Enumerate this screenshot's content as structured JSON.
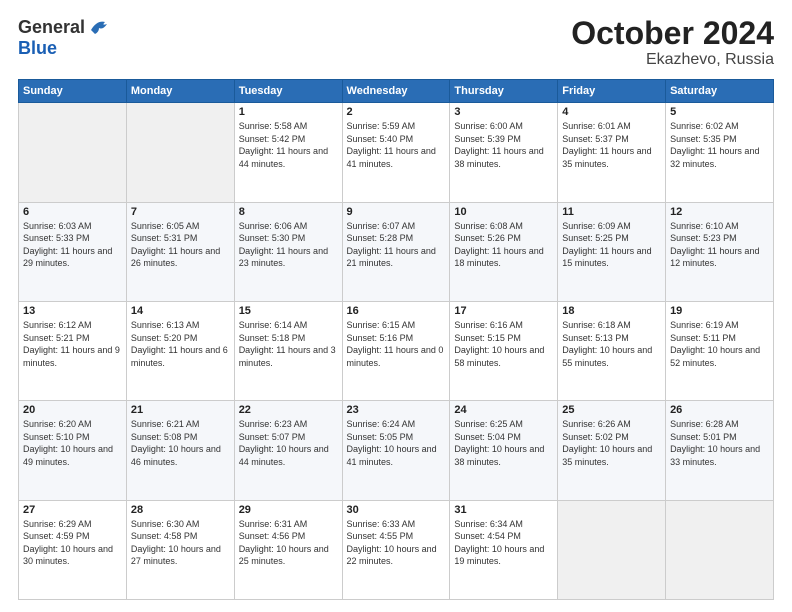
{
  "logo": {
    "general": "General",
    "blue": "Blue"
  },
  "header": {
    "month": "October 2024",
    "location": "Ekazhevo, Russia"
  },
  "days_of_week": [
    "Sunday",
    "Monday",
    "Tuesday",
    "Wednesday",
    "Thursday",
    "Friday",
    "Saturday"
  ],
  "weeks": [
    [
      {
        "day": "",
        "info": ""
      },
      {
        "day": "",
        "info": ""
      },
      {
        "day": "1",
        "info": "Sunrise: 5:58 AM\nSunset: 5:42 PM\nDaylight: 11 hours and 44 minutes."
      },
      {
        "day": "2",
        "info": "Sunrise: 5:59 AM\nSunset: 5:40 PM\nDaylight: 11 hours and 41 minutes."
      },
      {
        "day": "3",
        "info": "Sunrise: 6:00 AM\nSunset: 5:39 PM\nDaylight: 11 hours and 38 minutes."
      },
      {
        "day": "4",
        "info": "Sunrise: 6:01 AM\nSunset: 5:37 PM\nDaylight: 11 hours and 35 minutes."
      },
      {
        "day": "5",
        "info": "Sunrise: 6:02 AM\nSunset: 5:35 PM\nDaylight: 11 hours and 32 minutes."
      }
    ],
    [
      {
        "day": "6",
        "info": "Sunrise: 6:03 AM\nSunset: 5:33 PM\nDaylight: 11 hours and 29 minutes."
      },
      {
        "day": "7",
        "info": "Sunrise: 6:05 AM\nSunset: 5:31 PM\nDaylight: 11 hours and 26 minutes."
      },
      {
        "day": "8",
        "info": "Sunrise: 6:06 AM\nSunset: 5:30 PM\nDaylight: 11 hours and 23 minutes."
      },
      {
        "day": "9",
        "info": "Sunrise: 6:07 AM\nSunset: 5:28 PM\nDaylight: 11 hours and 21 minutes."
      },
      {
        "day": "10",
        "info": "Sunrise: 6:08 AM\nSunset: 5:26 PM\nDaylight: 11 hours and 18 minutes."
      },
      {
        "day": "11",
        "info": "Sunrise: 6:09 AM\nSunset: 5:25 PM\nDaylight: 11 hours and 15 minutes."
      },
      {
        "day": "12",
        "info": "Sunrise: 6:10 AM\nSunset: 5:23 PM\nDaylight: 11 hours and 12 minutes."
      }
    ],
    [
      {
        "day": "13",
        "info": "Sunrise: 6:12 AM\nSunset: 5:21 PM\nDaylight: 11 hours and 9 minutes."
      },
      {
        "day": "14",
        "info": "Sunrise: 6:13 AM\nSunset: 5:20 PM\nDaylight: 11 hours and 6 minutes."
      },
      {
        "day": "15",
        "info": "Sunrise: 6:14 AM\nSunset: 5:18 PM\nDaylight: 11 hours and 3 minutes."
      },
      {
        "day": "16",
        "info": "Sunrise: 6:15 AM\nSunset: 5:16 PM\nDaylight: 11 hours and 0 minutes."
      },
      {
        "day": "17",
        "info": "Sunrise: 6:16 AM\nSunset: 5:15 PM\nDaylight: 10 hours and 58 minutes."
      },
      {
        "day": "18",
        "info": "Sunrise: 6:18 AM\nSunset: 5:13 PM\nDaylight: 10 hours and 55 minutes."
      },
      {
        "day": "19",
        "info": "Sunrise: 6:19 AM\nSunset: 5:11 PM\nDaylight: 10 hours and 52 minutes."
      }
    ],
    [
      {
        "day": "20",
        "info": "Sunrise: 6:20 AM\nSunset: 5:10 PM\nDaylight: 10 hours and 49 minutes."
      },
      {
        "day": "21",
        "info": "Sunrise: 6:21 AM\nSunset: 5:08 PM\nDaylight: 10 hours and 46 minutes."
      },
      {
        "day": "22",
        "info": "Sunrise: 6:23 AM\nSunset: 5:07 PM\nDaylight: 10 hours and 44 minutes."
      },
      {
        "day": "23",
        "info": "Sunrise: 6:24 AM\nSunset: 5:05 PM\nDaylight: 10 hours and 41 minutes."
      },
      {
        "day": "24",
        "info": "Sunrise: 6:25 AM\nSunset: 5:04 PM\nDaylight: 10 hours and 38 minutes."
      },
      {
        "day": "25",
        "info": "Sunrise: 6:26 AM\nSunset: 5:02 PM\nDaylight: 10 hours and 35 minutes."
      },
      {
        "day": "26",
        "info": "Sunrise: 6:28 AM\nSunset: 5:01 PM\nDaylight: 10 hours and 33 minutes."
      }
    ],
    [
      {
        "day": "27",
        "info": "Sunrise: 6:29 AM\nSunset: 4:59 PM\nDaylight: 10 hours and 30 minutes."
      },
      {
        "day": "28",
        "info": "Sunrise: 6:30 AM\nSunset: 4:58 PM\nDaylight: 10 hours and 27 minutes."
      },
      {
        "day": "29",
        "info": "Sunrise: 6:31 AM\nSunset: 4:56 PM\nDaylight: 10 hours and 25 minutes."
      },
      {
        "day": "30",
        "info": "Sunrise: 6:33 AM\nSunset: 4:55 PM\nDaylight: 10 hours and 22 minutes."
      },
      {
        "day": "31",
        "info": "Sunrise: 6:34 AM\nSunset: 4:54 PM\nDaylight: 10 hours and 19 minutes."
      },
      {
        "day": "",
        "info": ""
      },
      {
        "day": "",
        "info": ""
      }
    ]
  ]
}
